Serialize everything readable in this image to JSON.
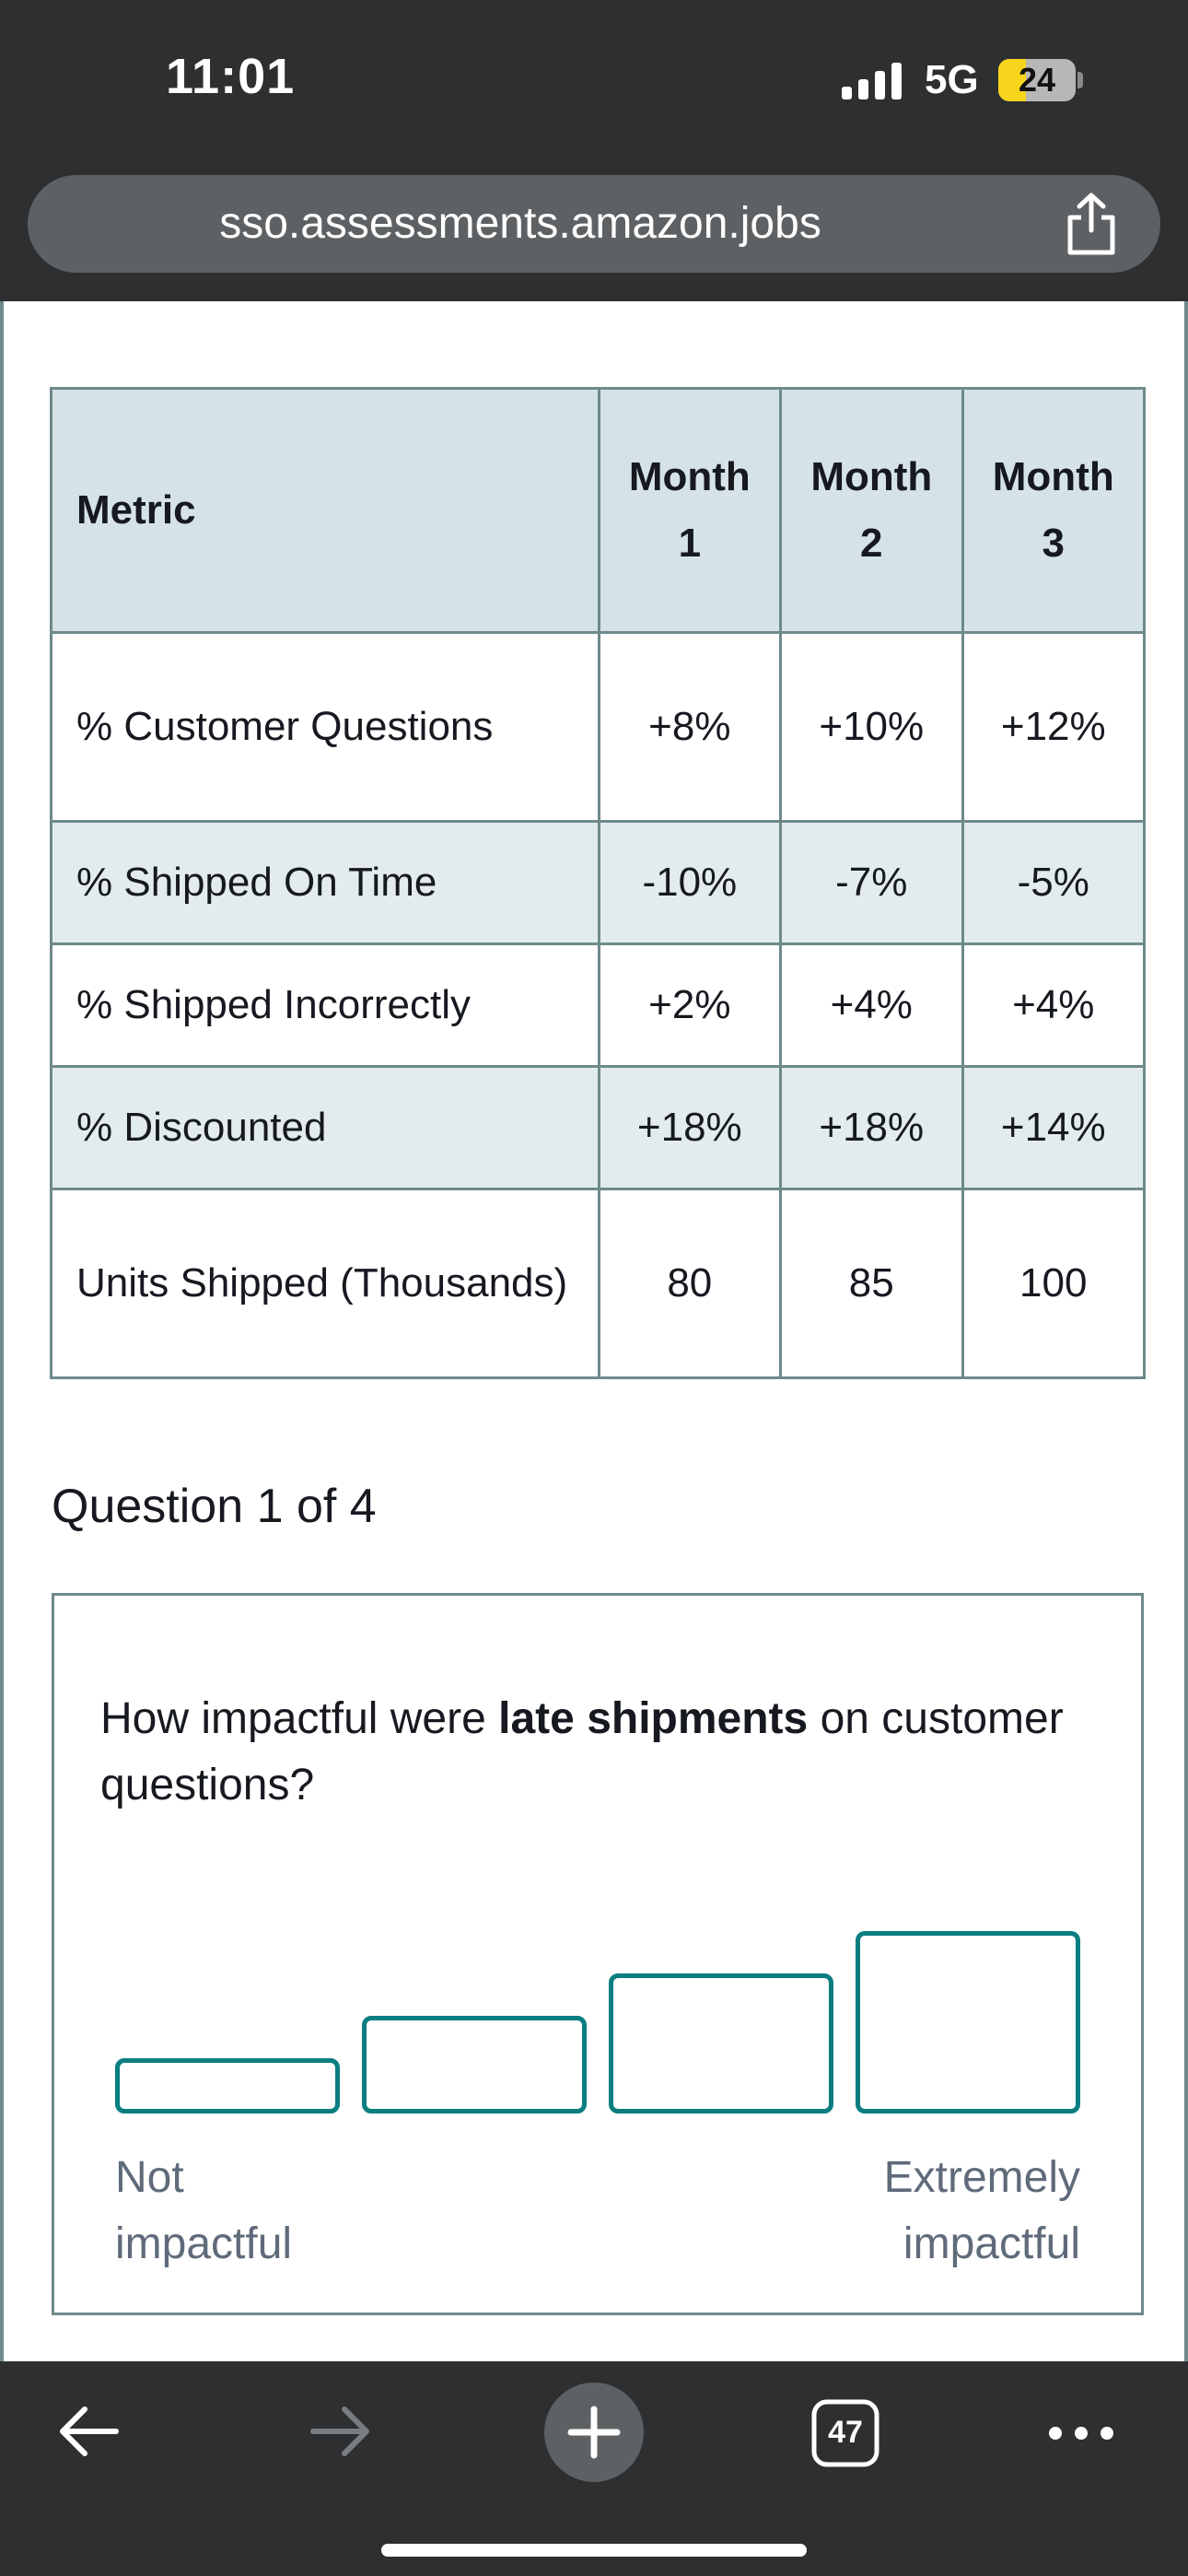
{
  "status_bar": {
    "time": "11:01",
    "network": "5G",
    "battery": "24"
  },
  "browser": {
    "url": "sso.assessments.amazon.jobs",
    "tab_count": "47"
  },
  "table": {
    "headers": {
      "metric": "Metric",
      "months": [
        {
          "word": "Month",
          "num": "1"
        },
        {
          "word": "Month",
          "num": "2"
        },
        {
          "word": "Month",
          "num": "3"
        }
      ]
    },
    "rows": [
      {
        "metric": "% Customer Questions",
        "values": [
          "+8%",
          "+10%",
          "+12%"
        ]
      },
      {
        "metric": "% Shipped On Time",
        "values": [
          "-10%",
          "-7%",
          "-5%"
        ]
      },
      {
        "metric": "% Shipped Incorrectly",
        "values": [
          "+2%",
          "+4%",
          "+4%"
        ]
      },
      {
        "metric": "% Discounted",
        "values": [
          "+18%",
          "+18%",
          "+14%"
        ]
      },
      {
        "metric": "Units Shipped (Thousands)",
        "values": [
          "80",
          "85",
          "100"
        ]
      }
    ]
  },
  "question": {
    "number": "Question 1 of 4",
    "text_before": "How impactful were ",
    "text_bold": "late shipments",
    "text_after": " on customer questions?",
    "scale_low": "Not impactful",
    "scale_high": "Extremely impactful"
  },
  "colors": {
    "accent": "#0a7e80",
    "header_bg": "#d5e3e6",
    "alt_row_bg": "#e3eced",
    "border": "#6e8a8a",
    "bar_bg": "#2d2f31"
  },
  "icons": [
    "share-icon",
    "back-arrow-icon",
    "forward-arrow-icon",
    "new-tab-plus-icon",
    "tabs-icon",
    "more-icon",
    "signal-icon",
    "battery-icon"
  ]
}
